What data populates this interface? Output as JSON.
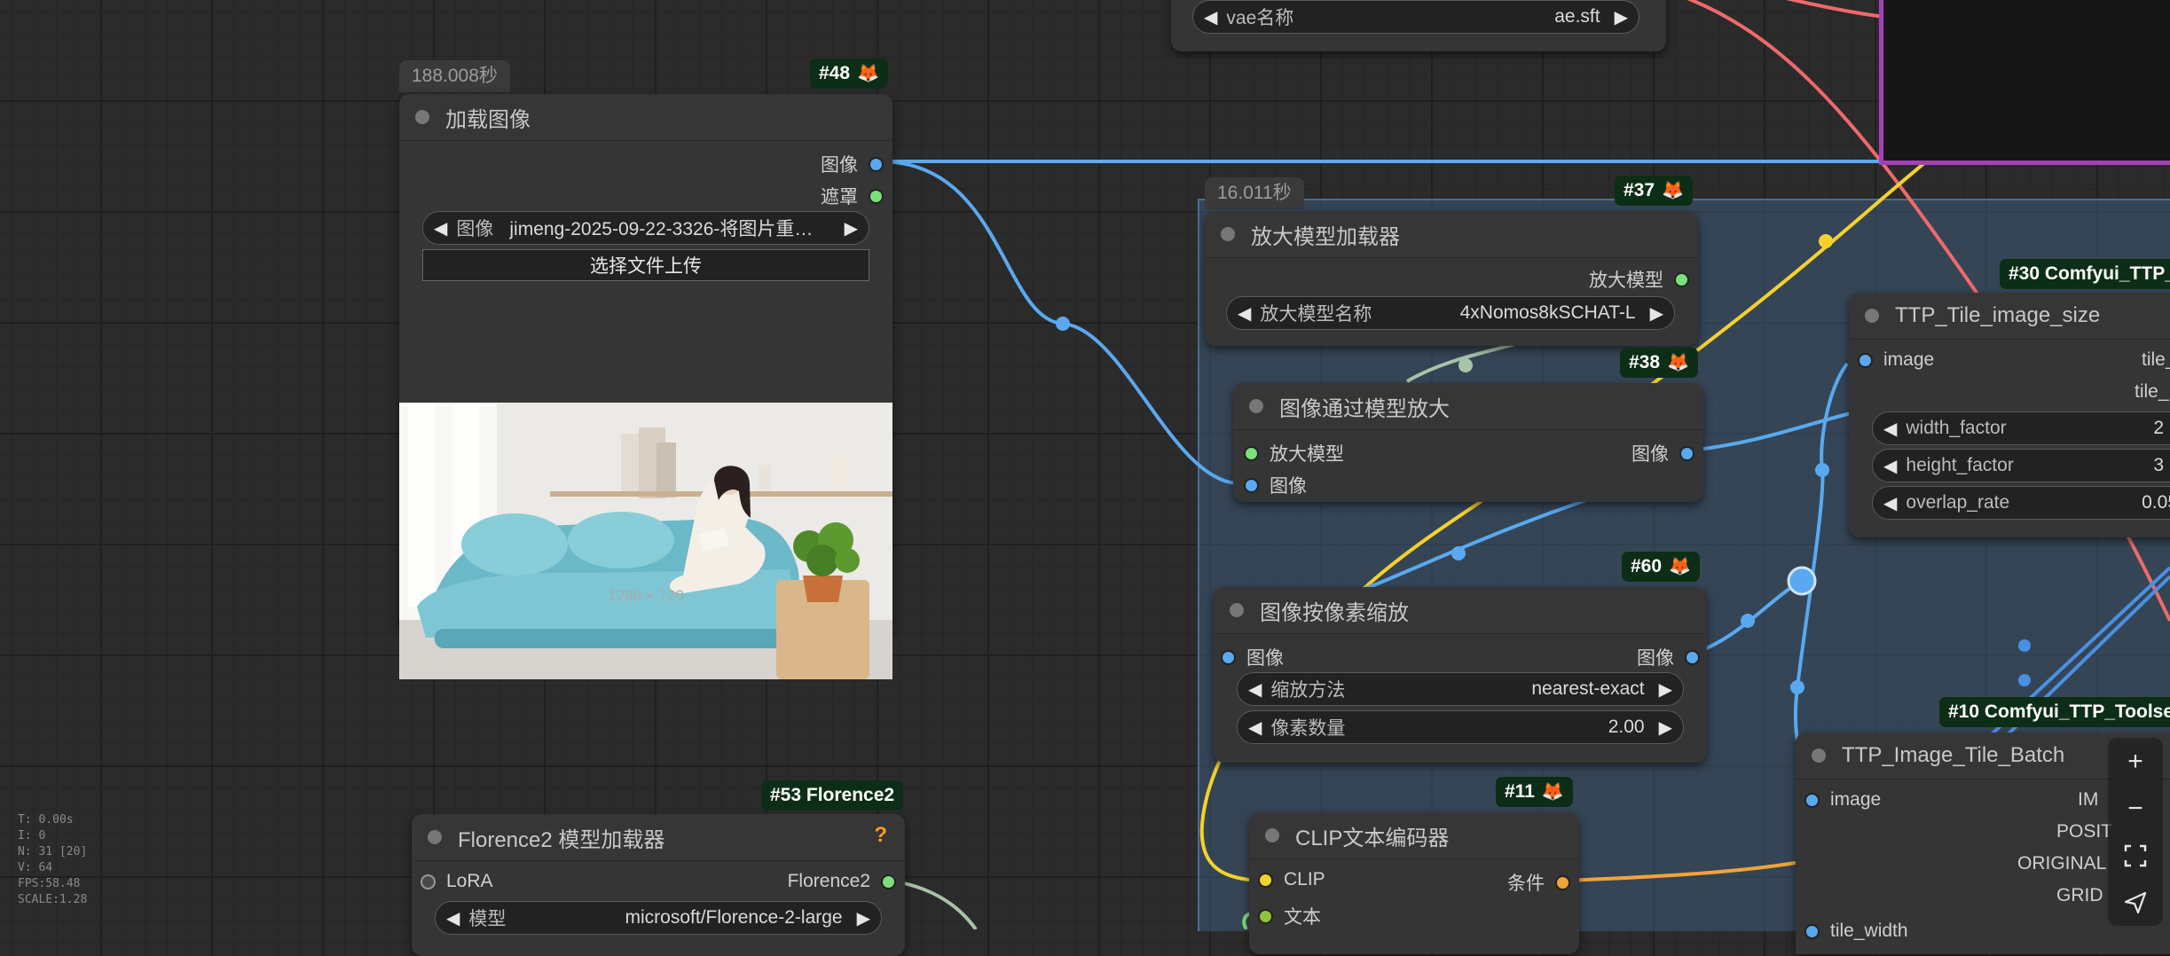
{
  "nodes": {
    "vae": {
      "widget_label": "vae名称",
      "widget_value": "ae.sft"
    },
    "load_image": {
      "badge": "#48",
      "time": "188.008秒",
      "title": "加载图像",
      "out_image": "图像",
      "out_mask": "遮罩",
      "widget_label": "图像",
      "widget_value": "jimeng-2025-09-22-3326-将图片重…",
      "upload_label": "选择文件上传",
      "image_size": "1280 × 720"
    },
    "upscale_loader": {
      "badge": "#37",
      "time": "16.011秒",
      "title": "放大模型加载器",
      "out_model": "放大模型",
      "widget_label": "放大模型名称",
      "widget_value": "4xNomos8kSCHAT-L"
    },
    "upscale_with_model": {
      "badge": "#38",
      "title": "图像通过模型放大",
      "in_model": "放大模型",
      "in_image": "图像",
      "out_image": "图像"
    },
    "scale_by_pixels": {
      "badge": "#60",
      "title": "图像按像素缩放",
      "in_image": "图像",
      "out_image": "图像",
      "w1_label": "缩放方法",
      "w1_value": "nearest-exact",
      "w2_label": "像素数量",
      "w2_value": "2.00"
    },
    "tile_image_size": {
      "badge": "#30 Comfyui_TTP_",
      "title": "TTP_Tile_image_size",
      "in_image": "image",
      "out_1": "tile_",
      "out_2": "tile_",
      "w1_label": "width_factor",
      "w1_value": "2",
      "w2_label": "height_factor",
      "w2_value": "3",
      "w3_label": "overlap_rate",
      "w3_value": "0.05"
    },
    "tile_batch": {
      "badge": "#10 Comfyui_TTP_Toolse",
      "title": "TTP_Image_Tile_Batch",
      "in_image": "image",
      "in_tile_width": "tile_width",
      "outputs": [
        "IM",
        "POSIT",
        "ORIGINAL",
        "GRID"
      ],
      "help": "?"
    },
    "florence": {
      "badge": "#53 Florence2",
      "title": "Florence2 模型加载器",
      "help": "?",
      "in_lora": "LoRA",
      "out_model": "Florence2",
      "widget_label": "模型",
      "widget_value": "microsoft/Florence-2-large"
    },
    "clip": {
      "badge": "#11",
      "title": "CLIP文本编码器",
      "in_clip": "CLIP",
      "in_text": "文本",
      "out_cond": "条件"
    }
  },
  "stats": [
    "T: 0.00s",
    "I: 0",
    "N: 31 [20]",
    "V: 64",
    "FPS:58.48",
    "SCALE:1.28"
  ],
  "toolbar": [
    "zoom-in",
    "zoom-out",
    "fit-view",
    "arrange"
  ],
  "colors": {
    "image_wire": "#5aa9f0",
    "clip_wire": "#f5d12c",
    "cond_wire": "#f2a33a",
    "vae_wire": "#ef6a6a",
    "model_wire": "#a8c4a8",
    "mask_wire": "#7be07b"
  }
}
